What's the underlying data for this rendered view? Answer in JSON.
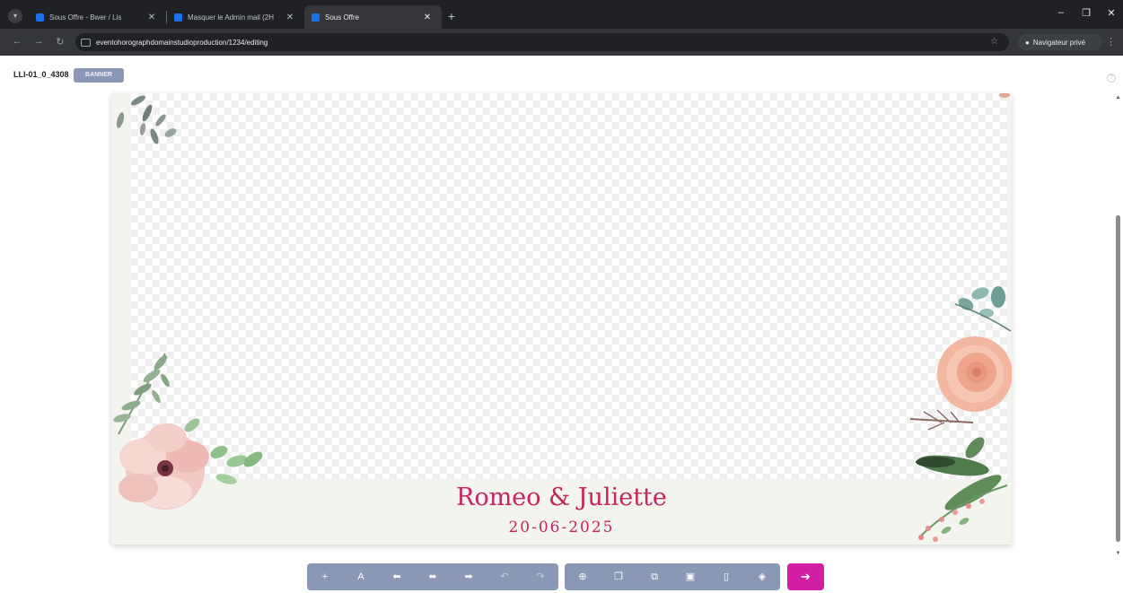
{
  "browser": {
    "tabs": [
      {
        "title": "Sous Offre - Bwer / Lis",
        "active": false
      },
      {
        "title": "Masquer le Admin mail (2H",
        "active": false
      },
      {
        "title": "Sous Offre",
        "active": true
      }
    ],
    "url": "eventohorographdomainstudioproduction/1234/editing",
    "profile_label": "Navigateur privé"
  },
  "header": {
    "doc_id": "LLI-01_0_4308",
    "status_badge": "BANNER"
  },
  "card": {
    "names": "Romeo & Juliette",
    "date": "20-06-2025",
    "colors": {
      "accent": "#c4245f",
      "paper": "#f4f4ef"
    }
  },
  "editor_toolbar": {
    "text_group": [
      {
        "icon": "add-text-icon",
        "glyph": "+"
      },
      {
        "icon": "font-icon",
        "glyph": "A"
      },
      {
        "icon": "align-left-icon",
        "glyph": "⬅"
      },
      {
        "icon": "align-center-icon",
        "glyph": "⬌"
      },
      {
        "icon": "align-right-icon",
        "glyph": "➡"
      },
      {
        "icon": "undo-icon",
        "glyph": "↶"
      },
      {
        "icon": "redo-icon",
        "glyph": "↷"
      }
    ],
    "object_group": [
      {
        "icon": "zoom-icon",
        "glyph": "⊕"
      },
      {
        "icon": "copy-icon",
        "glyph": "❐"
      },
      {
        "icon": "duplicate-icon",
        "glyph": "⧉"
      },
      {
        "icon": "save-icon",
        "glyph": "▣"
      },
      {
        "icon": "delete-icon",
        "glyph": "▯"
      },
      {
        "icon": "layer-icon",
        "glyph": "◈"
      }
    ],
    "next_glyph": "➔",
    "colors": {
      "toolbar": "#8a97b5",
      "primary": "#d11ea5"
    }
  }
}
